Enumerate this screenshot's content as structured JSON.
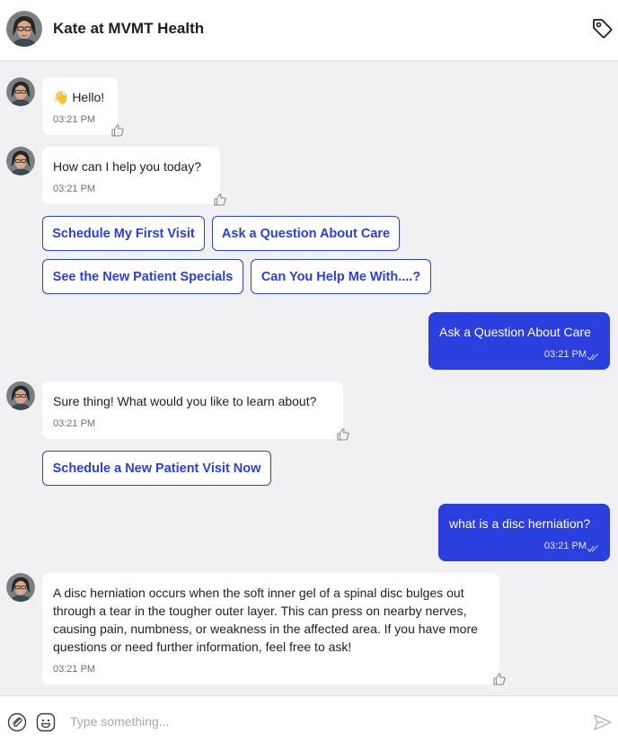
{
  "header": {
    "title": "Kate at MVMT Health",
    "avatar_icon": "agent-avatar",
    "tag_icon": "tag-icon"
  },
  "messages": [
    {
      "from": "agent",
      "text": "👋 Hello!",
      "time": "03:21 PM"
    },
    {
      "from": "agent",
      "text": "How can I help you today?",
      "time": "03:21 PM"
    },
    {
      "from": "user",
      "text": "Ask a Question About Care",
      "time": "03:21 PM"
    },
    {
      "from": "agent",
      "text": "Sure thing! What would you like to learn about?",
      "time": "03:21 PM"
    },
    {
      "from": "user",
      "text": "what is a disc herniation?",
      "time": "03:21 PM"
    },
    {
      "from": "agent",
      "text": "A disc herniation occurs when the soft inner gel of a spinal disc bulges out through a tear in the tougher outer layer. This can press on nearby nerves, causing pain, numbness, or weakness in the affected area. If you have more questions or need further information, feel free to ask!",
      "time": "03:21 PM"
    }
  ],
  "quick_replies_1": [
    "Schedule My First Visit",
    "Ask a Question About Care",
    "See the New Patient Specials",
    "Can You Help Me With....?"
  ],
  "quick_replies_2": [
    "Schedule a New Patient Visit Now"
  ],
  "composer": {
    "placeholder": "Type something...",
    "left_icons": [
      "attachment-icon",
      "emoji-icon"
    ],
    "send_icon": "send-icon"
  },
  "colors": {
    "accent": "#2b3fde",
    "background": "#f1f1f3",
    "bubble": "#ffffff"
  }
}
